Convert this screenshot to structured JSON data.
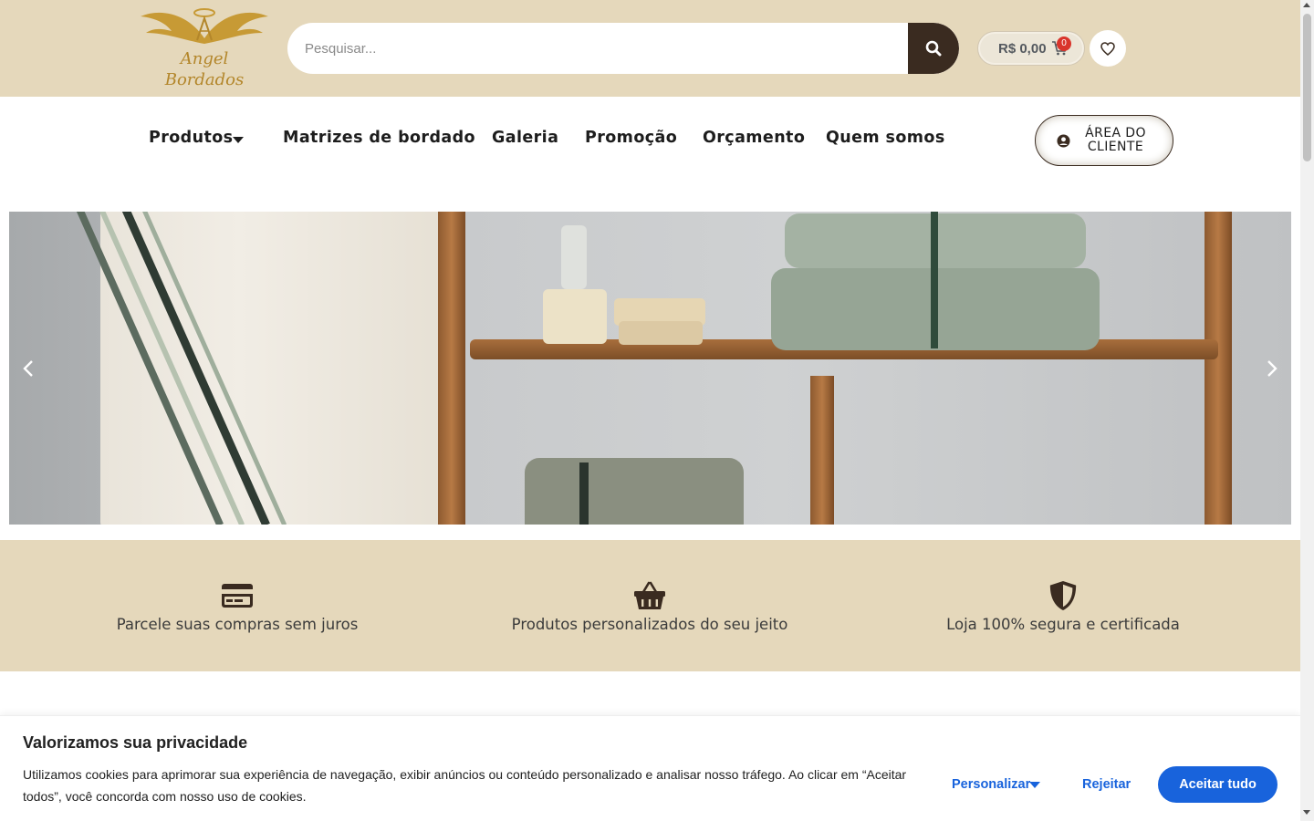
{
  "header": {
    "logo_line1": "Angel",
    "logo_line2": "Bordados",
    "search_placeholder": "Pesquisar...",
    "search_icon": "search-icon",
    "cart_amount": "R$ 0,00",
    "cart_count": "0",
    "cart_icon": "cart-icon",
    "wishlist_icon": "heart-icon"
  },
  "nav": {
    "items": [
      {
        "label": "Produtos"
      },
      {
        "label": "Matrizes de bordado"
      },
      {
        "label": "Galeria"
      },
      {
        "label": "Promoção"
      },
      {
        "label": "Orçamento"
      },
      {
        "label": "Quem somos"
      }
    ],
    "client_area": "ÁREA DO CLIENTE"
  },
  "banner": {
    "prev_icon": "chevron-left-icon",
    "next_icon": "chevron-right-icon"
  },
  "features": [
    {
      "icon": "credit-card-icon",
      "text": "Parcele suas compras sem juros"
    },
    {
      "icon": "basket-icon",
      "text": "Produtos personalizados do seu jeito"
    },
    {
      "icon": "shield-icon",
      "text": "Loja 100% segura e certificada"
    }
  ],
  "cookie": {
    "title": "Valorizamos sua privacidade",
    "text": "Utilizamos cookies para aprimorar sua experiência de navegação, exibir anúncios ou conteúdo personalizado e analisar nosso tráfego. Ao clicar em “Aceitar todos”, você concorda com nosso uso de cookies.",
    "customize": "Personalizar",
    "reject": "Rejeitar",
    "accept": "Aceitar tudo"
  },
  "colors": {
    "header_bg": "#e5d8bb",
    "dark_brown": "#3a2b20",
    "gold": "#b3862a",
    "cookie_blue": "#1863dc"
  }
}
